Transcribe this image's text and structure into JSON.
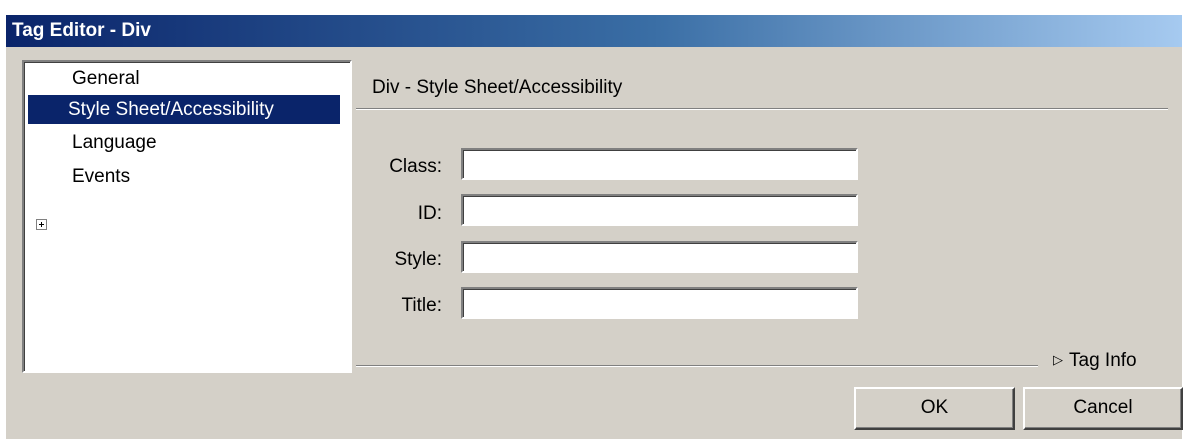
{
  "window": {
    "title": "Tag Editor - Div"
  },
  "tree": {
    "items": [
      {
        "label": "General"
      },
      {
        "label": "Style Sheet/Accessibility",
        "selected": true
      },
      {
        "label": "Language"
      },
      {
        "label": "Events",
        "expandable": true
      }
    ]
  },
  "panel": {
    "title": "Div - Style Sheet/Accessibility",
    "fields": [
      {
        "label": "Class:",
        "value": ""
      },
      {
        "label": "ID:",
        "value": ""
      },
      {
        "label": "Style:",
        "value": ""
      },
      {
        "label": "Title:",
        "value": ""
      }
    ],
    "tag_info": "Tag Info",
    "tag_info_icon": "triangle-right-icon"
  },
  "buttons": {
    "ok": "OK",
    "cancel": "Cancel"
  },
  "colors": {
    "title_start": "#0a246a",
    "title_end": "#a6caf0",
    "selection": "#0a246a",
    "face": "#d4d0c8"
  }
}
